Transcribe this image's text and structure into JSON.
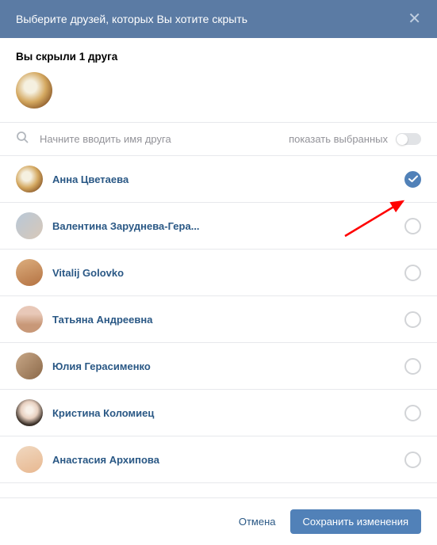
{
  "header": {
    "title": "Выберите друзей, которых Вы хотите скрыть"
  },
  "hidden": {
    "title": "Вы скрыли 1 друга"
  },
  "search": {
    "placeholder": "Начните вводить имя друга",
    "show_selected_label": "показать выбранных"
  },
  "friends": [
    {
      "name": "Анна Цветаева",
      "checked": true
    },
    {
      "name": "Валентина Заруднева-Гера...",
      "checked": false
    },
    {
      "name": "Vitalij Golovko",
      "checked": false
    },
    {
      "name": "Татьяна Андреевна",
      "checked": false
    },
    {
      "name": "Юлия Герасименко",
      "checked": false
    },
    {
      "name": "Кристина Коломиец",
      "checked": false
    },
    {
      "name": "Анастасия Архипова",
      "checked": false
    }
  ],
  "footer": {
    "cancel": "Отмена",
    "save": "Сохранить изменения"
  }
}
